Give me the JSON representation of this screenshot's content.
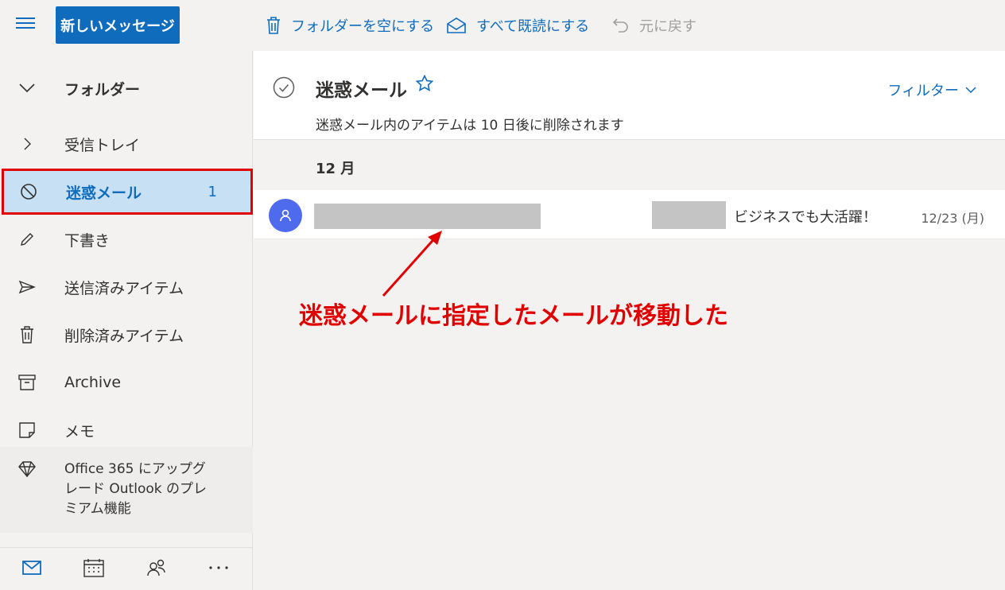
{
  "toolbar": {
    "new_message": "新しいメッセージ",
    "empty_folder": "フォルダーを空にする",
    "mark_all_read": "すべて既読にする",
    "undo": "元に戻す"
  },
  "sidebar": {
    "folders_label": "フォルダー",
    "items": [
      {
        "label": "受信トレイ",
        "icon": "chevron-right-icon"
      },
      {
        "label": "迷惑メール",
        "icon": "block-icon",
        "count": "1",
        "selected": true
      },
      {
        "label": "下書き",
        "icon": "pencil-icon"
      },
      {
        "label": "送信済みアイテム",
        "icon": "send-icon"
      },
      {
        "label": "削除済みアイテム",
        "icon": "trash-icon"
      },
      {
        "label": "Archive",
        "icon": "archive-icon"
      },
      {
        "label": "メモ",
        "icon": "note-icon"
      }
    ],
    "premium_text": "Office 365 にアップグレード Outlook のプレミアム機能",
    "bottom_nav": [
      "mail-icon",
      "calendar-icon",
      "people-icon",
      "more-icon"
    ]
  },
  "main": {
    "folder_title": "迷惑メール",
    "filter_label": "フィルター",
    "notice": "迷惑メール内のアイテムは 10 日後に削除されます",
    "month_header": "12 月",
    "messages": [
      {
        "subject": "ビジネスでも大活躍！",
        "date": "12/23 (月)"
      }
    ]
  },
  "annotation": {
    "text": "迷惑メールに指定したメールが移動した",
    "color": "#e00000"
  },
  "colors": {
    "accent": "#0f6cbd",
    "selected_bg": "#c7e0f4",
    "highlight_border": "#e00000",
    "avatar": "#4f6bed"
  }
}
